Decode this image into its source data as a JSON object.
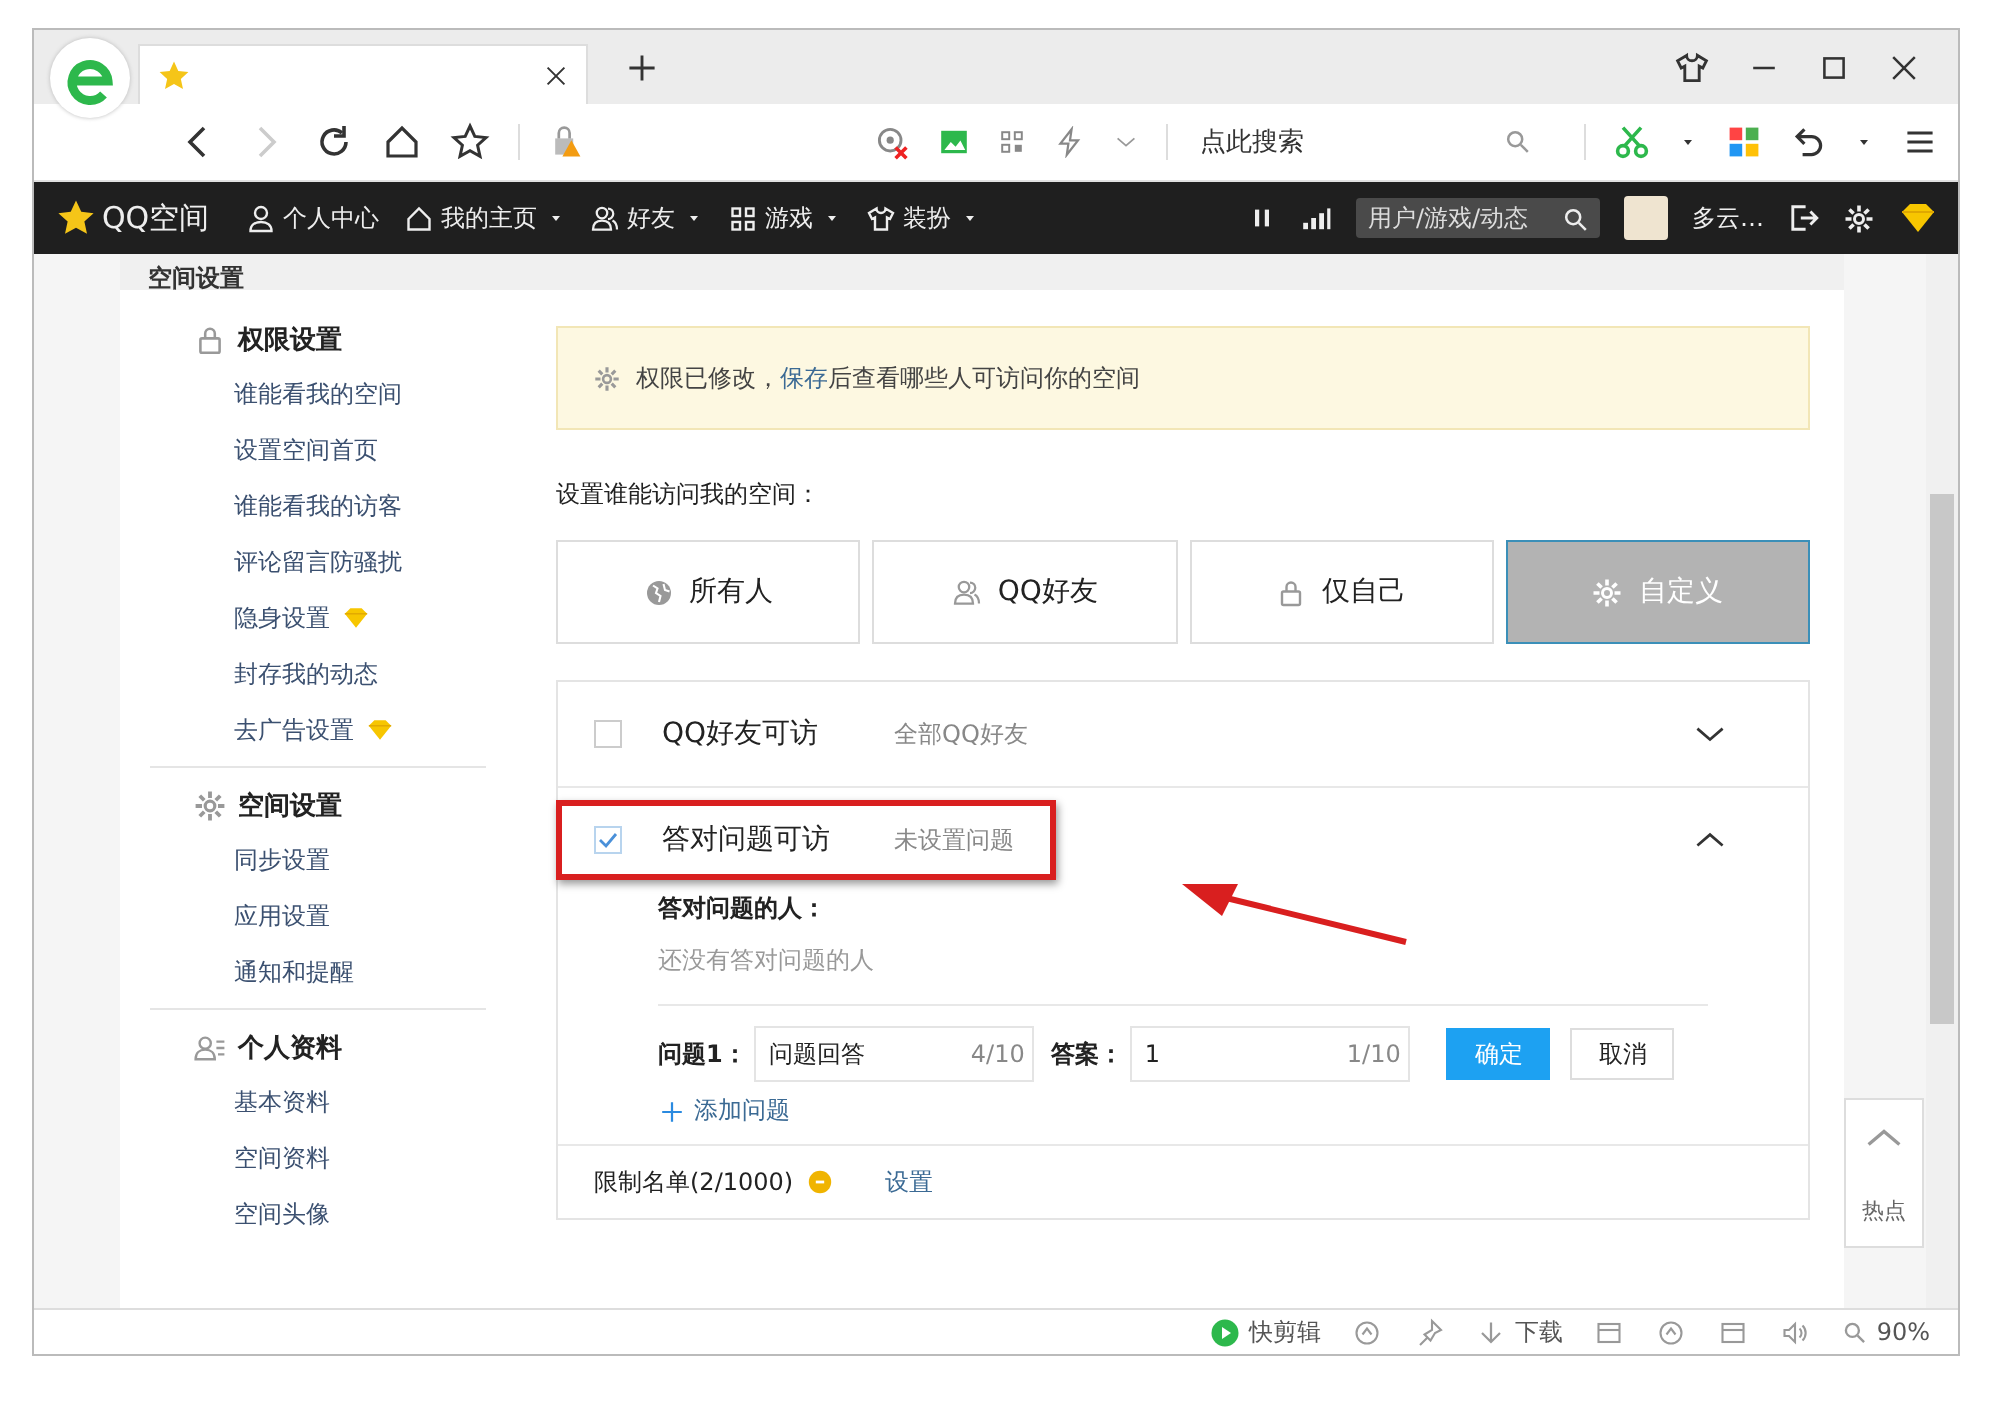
{
  "browser": {
    "search": {
      "placeholder": "点此搜索"
    }
  },
  "topbar": {
    "logo": "QQ空间",
    "items": [
      {
        "kind": "person",
        "label": "个人中心",
        "dropdown": false
      },
      {
        "kind": "home",
        "label": "我的主页",
        "dropdown": true
      },
      {
        "kind": "friends",
        "label": "好友",
        "dropdown": true
      },
      {
        "kind": "grid",
        "label": "游戏",
        "dropdown": true
      },
      {
        "kind": "shirt",
        "label": "装扮",
        "dropdown": true
      }
    ],
    "search": {
      "placeholder": "用户/游戏/动态"
    },
    "user": "多云…"
  },
  "page_title": "空间设置",
  "sidebar": [
    {
      "kind": "lock",
      "title": "权限设置",
      "items": [
        {
          "label": "谁能看我的空间",
          "vip": false
        },
        {
          "label": "设置空间首页",
          "vip": false
        },
        {
          "label": "谁能看我的访客",
          "vip": false
        },
        {
          "label": "评论留言防骚扰",
          "vip": false
        },
        {
          "label": "隐身设置",
          "vip": true
        },
        {
          "label": "封存我的动态",
          "vip": false
        },
        {
          "label": "去广告设置",
          "vip": true
        }
      ]
    },
    {
      "kind": "gear",
      "title": "空间设置",
      "items": [
        {
          "label": "同步设置",
          "vip": false
        },
        {
          "label": "应用设置",
          "vip": false
        },
        {
          "label": "通知和提醒",
          "vip": false
        }
      ]
    },
    {
      "kind": "profile",
      "title": "个人资料",
      "items": [
        {
          "label": "基本资料",
          "vip": false
        },
        {
          "label": "空间资料",
          "vip": false
        },
        {
          "label": "空间头像",
          "vip": false
        }
      ]
    }
  ],
  "notice": {
    "before": "权限已修改，",
    "link": "保存",
    "after": "后查看哪些人可访问你的空间"
  },
  "prompt": "设置谁能访问我的空间：",
  "options": [
    {
      "kind": "globe",
      "label": "所有人",
      "selected": false
    },
    {
      "kind": "friends",
      "label": "QQ好友",
      "selected": false
    },
    {
      "kind": "lock",
      "label": "仅自己",
      "selected": false
    },
    {
      "kind": "gear",
      "label": "自定义",
      "selected": true
    }
  ],
  "rules": [
    {
      "label": "QQ好友可访",
      "detail": "全部QQ好友",
      "checked": false,
      "expanded": false
    },
    {
      "label": "答对问题可访",
      "detail": "未设置问题",
      "checked": true,
      "expanded": true
    }
  ],
  "answers": {
    "label": "答对问题的人：",
    "empty": "还没有答对问题的人",
    "question_label": "问题1：",
    "question": "问题回答",
    "question_count": "4/10",
    "answer_label": "答案：",
    "answer": "1",
    "answer_count": "1/10",
    "confirm": "确定",
    "cancel": "取消",
    "add": "添加问题"
  },
  "blocklist": {
    "label": "限制名单(2/1000)",
    "link": "设置"
  },
  "hot": "热点",
  "status_bar": {
    "clip": "快剪辑",
    "download": "下载",
    "zoom": "90%"
  }
}
